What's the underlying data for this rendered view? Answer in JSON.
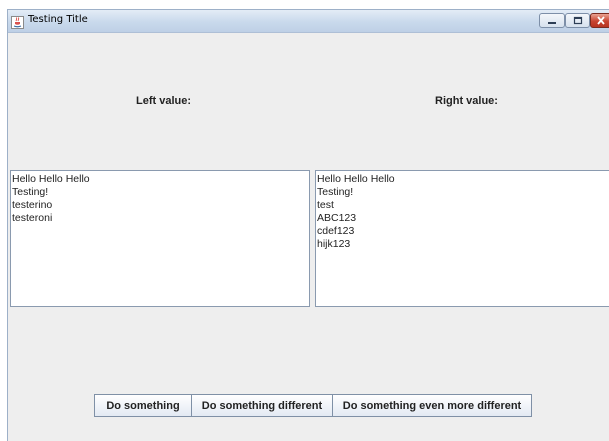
{
  "window": {
    "title": "Testing Title"
  },
  "labels": {
    "left": "Left value:",
    "right": "Right value:"
  },
  "left_list": {
    "items": [
      "Hello Hello Hello",
      "Testing!",
      "testerino",
      "testeroni"
    ]
  },
  "right_list": {
    "items": [
      "Hello Hello Hello",
      "Testing!",
      "test",
      "ABC123",
      "cdef123",
      "hijk123"
    ]
  },
  "buttons": {
    "do_something": "Do something",
    "do_something_different": "Do something different",
    "do_something_more": "Do something even more different"
  },
  "icons": {
    "app": "java-cup-icon",
    "minimize": "minimize-icon",
    "maximize": "maximize-icon",
    "close": "close-icon"
  }
}
